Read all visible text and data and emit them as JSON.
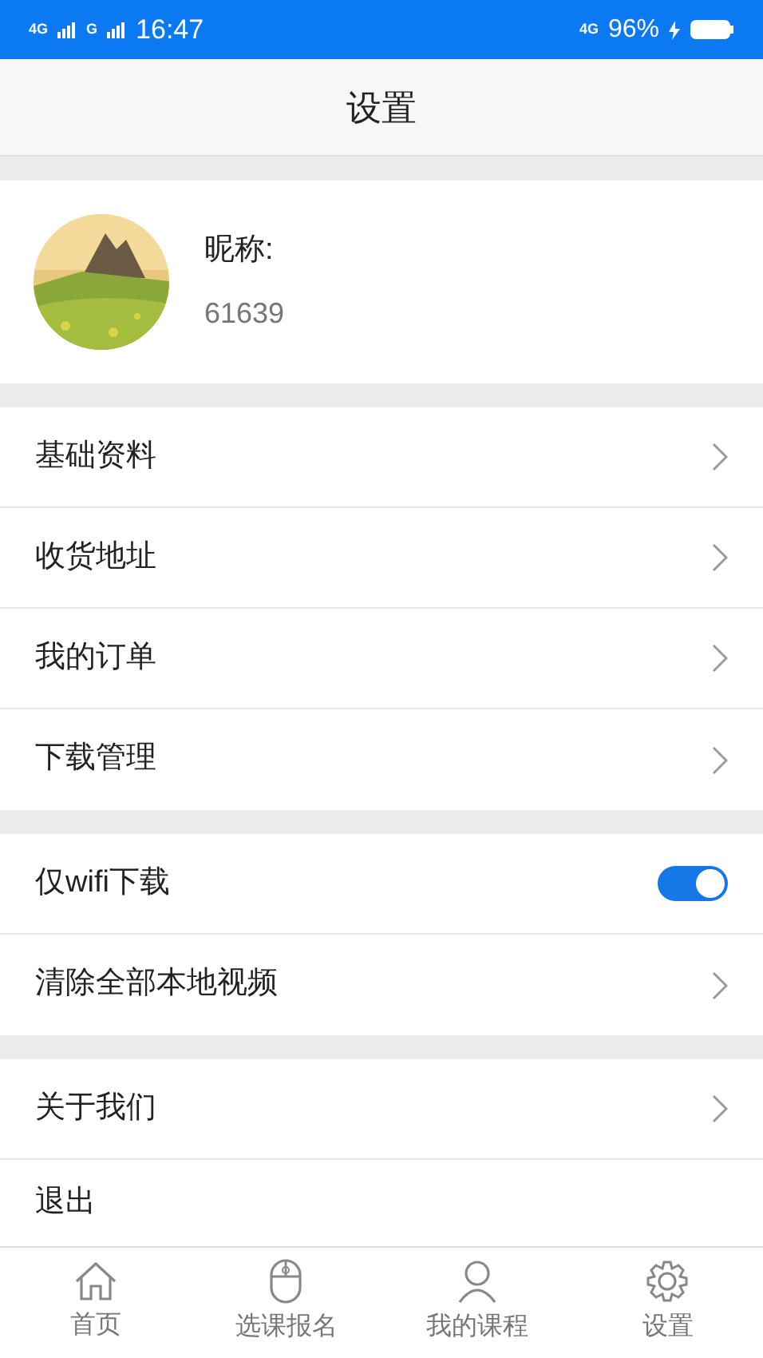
{
  "status_bar": {
    "left_network": "4G",
    "left_network_2": "G",
    "time": "16:47",
    "right_network": "4G",
    "battery": "96%"
  },
  "header": {
    "title": "设置"
  },
  "profile": {
    "nickname_label": "昵称:",
    "user_id": "61639"
  },
  "groups": [
    [
      {
        "kind": "link",
        "label": "基础资料"
      },
      {
        "kind": "link",
        "label": "收货地址"
      },
      {
        "kind": "link",
        "label": "我的订单"
      },
      {
        "kind": "link",
        "label": "下载管理"
      }
    ],
    [
      {
        "kind": "toggle",
        "label": "仅wifi下载",
        "on": true
      },
      {
        "kind": "link",
        "label": "清除全部本地视频"
      }
    ],
    [
      {
        "kind": "link",
        "label": "关于我们"
      },
      {
        "kind": "plain",
        "label": "退出"
      }
    ]
  ],
  "tab_bar": [
    {
      "label": "首页",
      "selected": false
    },
    {
      "label": "选课报名",
      "selected": false
    },
    {
      "label": "我的课程",
      "selected": false
    },
    {
      "label": "设置",
      "selected": false
    }
  ]
}
